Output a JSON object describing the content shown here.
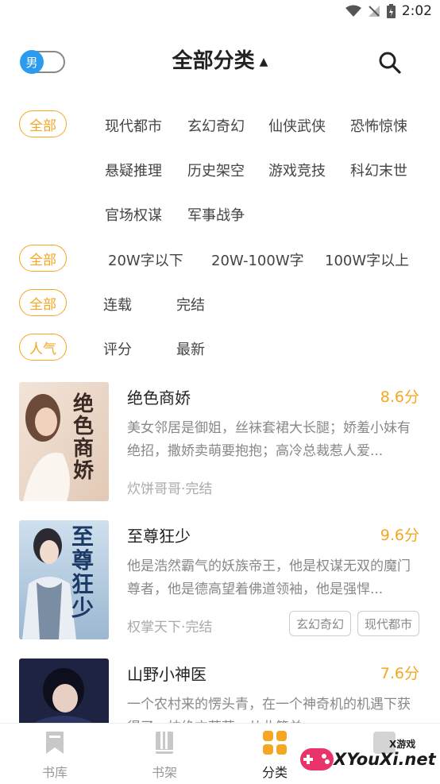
{
  "status": {
    "time": "2:02"
  },
  "header": {
    "gender_toggle": "男",
    "title": "全部分类"
  },
  "filters": {
    "category": {
      "selected": "全部",
      "options": [
        "现代都市",
        "玄幻奇幻",
        "仙侠武侠",
        "恐怖惊悚",
        "悬疑推理",
        "历史架空",
        "游戏竞技",
        "科幻末世",
        "官场权谋",
        "军事战争"
      ]
    },
    "wordcount": {
      "selected": "全部",
      "options": [
        "20W字以下",
        "20W-100W字",
        "100W字以上"
      ]
    },
    "status": {
      "selected": "全部",
      "options": [
        "连载",
        "完结"
      ]
    },
    "sort": {
      "selected": "人气",
      "options": [
        "评分",
        "最新"
      ]
    }
  },
  "books": [
    {
      "title": "绝色商娇",
      "score": "8.6分",
      "desc": "美女邻居是御姐，丝袜套裙大长腿；娇羞小妹有绝招，撒娇卖萌要抱抱；高冷总裁惹人爱...",
      "meta": "炊饼哥哥·完结",
      "tags": [],
      "cover_text": "绝色商娇"
    },
    {
      "title": "至尊狂少",
      "score": "9.6分",
      "desc": "他是浩然霸气的妖族帝王，他是权谋无双的魔门尊者，他是德高望着佛道领袖，他是强悍...",
      "meta": "权掌天下·完结",
      "tags": [
        "玄幻奇幻",
        "现代都市"
      ],
      "cover_text": "至尊狂少"
    },
    {
      "title": "山野小神医",
      "score": "7.6分",
      "desc": "一个农村来的愣头青，在一个神奇机的机遇下获得了一枝绝方草药，从此简单...",
      "meta": "",
      "tags": [],
      "cover_text": ""
    }
  ],
  "tabs": [
    {
      "label": "书库",
      "icon": "bookmark-icon"
    },
    {
      "label": "书架",
      "icon": "bookshelf-icon"
    },
    {
      "label": "分类",
      "icon": "grid-icon"
    },
    {
      "label": "",
      "icon": "user-icon"
    }
  ],
  "watermark": {
    "text": "XYouXi.net",
    "small": "X游戏"
  },
  "colors": {
    "accent": "#f5a623",
    "toggle": "#2b9bf0"
  }
}
